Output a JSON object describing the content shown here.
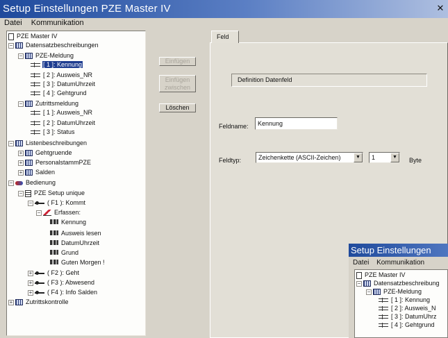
{
  "window": {
    "title": "Setup Einstellungen PZE Master IV",
    "close_glyph": "✕"
  },
  "menu": {
    "file": "Datei",
    "communication": "Kommunikation"
  },
  "tree": [
    {
      "label": "PZE Master IV",
      "icon": "doc-icon",
      "exp": ""
    },
    {
      "label": "Datensatzbeschreibungen",
      "icon": "grid-icon",
      "exp": "−"
    },
    {
      "label": "PZE-Meldung",
      "icon": "grid-icon",
      "exp": "−"
    },
    {
      "label": "[ 1 ]: Kennung",
      "icon": "field-icon",
      "exp": "",
      "selected": true
    },
    {
      "label": "[ 2 ]: Ausweis_NR",
      "icon": "field-icon",
      "exp": ""
    },
    {
      "label": "[ 3 ]: DatumUhrzeit",
      "icon": "field-icon",
      "exp": ""
    },
    {
      "label": "[ 4 ]: Gehtgrund",
      "icon": "field-icon",
      "exp": ""
    },
    {
      "label": "Zutrittsmeldung",
      "icon": "grid-icon",
      "exp": "−"
    },
    {
      "label": "[ 1 ]: Ausweis_NR",
      "icon": "field-icon",
      "exp": ""
    },
    {
      "label": "[ 2 ]: DatumUhrzeit",
      "icon": "field-icon",
      "exp": ""
    },
    {
      "label": "[ 3 ]: Status",
      "icon": "field-icon",
      "exp": ""
    },
    {
      "label": "Listenbeschreibungen",
      "icon": "grid-icon",
      "exp": "−"
    },
    {
      "label": "Gehtgruende",
      "icon": "grid-icon",
      "exp": "+"
    },
    {
      "label": "PersonalstammPZE",
      "icon": "grid-icon",
      "exp": "+"
    },
    {
      "label": "Salden",
      "icon": "grid-icon",
      "exp": "+"
    },
    {
      "label": "Bedienung",
      "icon": "key-icon",
      "exp": "−"
    },
    {
      "label": "PZE Setup unique",
      "icon": "settings-icon",
      "exp": "−"
    },
    {
      "label": "( F1 ): Kommt",
      "icon": "dot-icon",
      "exp": "−"
    },
    {
      "label": "Erfassen:",
      "icon": "pen-icon",
      "exp": "−"
    },
    {
      "label": "Kennung",
      "icon": "step-icon",
      "exp": ""
    },
    {
      "label": "Ausweis lesen",
      "icon": "step-icon",
      "exp": ""
    },
    {
      "label": "DatumUhrzeit",
      "icon": "step-icon",
      "exp": ""
    },
    {
      "label": "Grund",
      "icon": "step-icon",
      "exp": ""
    },
    {
      "label": "Guten Morgen !",
      "icon": "step-icon",
      "exp": ""
    },
    {
      "label": "( F2 ): Geht",
      "icon": "dot-icon",
      "exp": "+"
    },
    {
      "label": "( F3 ): Abwesend",
      "icon": "dot-icon",
      "exp": "+"
    },
    {
      "label": "( F4 ): Info Salden",
      "icon": "dot-icon",
      "exp": "+"
    },
    {
      "label": "Zutrittskontrolle",
      "icon": "grid-icon",
      "exp": "+"
    }
  ],
  "buttons": {
    "insert": "Einfügen",
    "insert_between_1": "Einfügen",
    "insert_between_2": "zwischen",
    "delete": "Löschen"
  },
  "tab": {
    "label": "Feld"
  },
  "panel": {
    "group_title": "Definition Datenfeld",
    "fieldname_label": "Feldname:",
    "fieldname_value": "Kennung",
    "fieldtype_label": "Feldtyp:",
    "fieldtype_value": "Zeichenkette (ASCII-Zeichen)",
    "length_value": "1",
    "unit_label": "Byte"
  },
  "second_window": {
    "title": "Setup Einstellungen",
    "menu_file": "Datei",
    "menu_communication": "Kommunikation",
    "tree": [
      "PZE Master IV",
      "Datensatzbeschreibung",
      "PZE-Meldung",
      "[ 1 ]: Kennung",
      "[ 2 ]: Ausweis_N",
      "[ 3 ]: DatumUhrz",
      "[ 4 ]: Gehtgrund"
    ]
  }
}
